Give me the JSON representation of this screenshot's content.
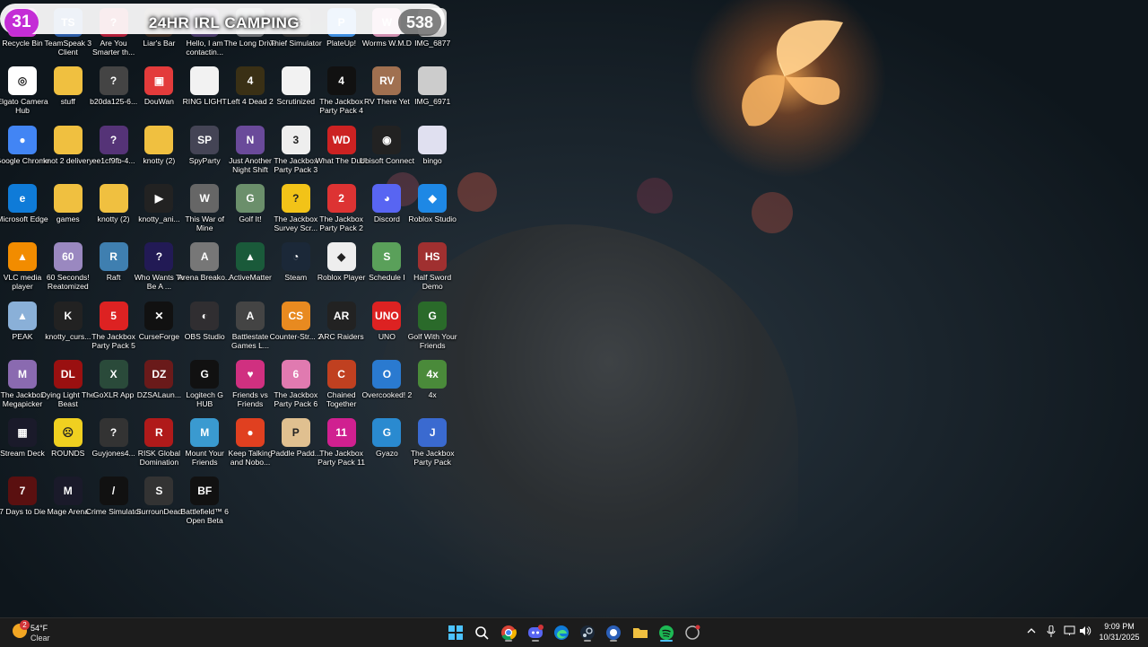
{
  "banner": {
    "left_count": "31",
    "title": "24HR IRL CAMPING",
    "right_count": "538"
  },
  "desktop_icons": [
    [
      "Recycle Bin",
      "recycle-bin-icon",
      "#cc33cc",
      ""
    ],
    [
      "TeamSpeak 3 Client",
      "teamspeak-icon",
      "#2d5ea8",
      "TS"
    ],
    [
      "Are You Smarter th...",
      "are-you-smarter-icon",
      "#b31f3a",
      "?"
    ],
    [
      "Liar's Bar",
      "liars-bar-icon",
      "#3a2a20",
      "LB"
    ],
    [
      "Hello, I am contactin...",
      "game-icon",
      "#4a3a6a",
      "H"
    ],
    [
      "The Long Drive",
      "the-long-drive-icon",
      "#6b6e72",
      "LD"
    ],
    [
      "Thief Simulator",
      "thief-simulator-icon",
      "#333",
      "TS"
    ],
    [
      "PlateUp!",
      "plateup-icon",
      "#3f8ee0",
      "P"
    ],
    [
      "Worms W.M.D",
      "worms-icon",
      "#d08fb0",
      "W"
    ],
    [
      "IMG_6877",
      "image-file-icon",
      "#ccc",
      ""
    ],
    [
      "Elgato Camera Hub",
      "elgato-camera-icon",
      "#fff",
      "◎"
    ],
    [
      "stuff",
      "folder-icon",
      "#f0c040",
      ""
    ],
    [
      "b20da125-6...",
      "file-icon",
      "#444",
      "?"
    ],
    [
      "DouWan",
      "douwan-icon",
      "#e33b3b",
      "▣"
    ],
    [
      "RING LIGHT",
      "text-file-icon",
      "#f2f2f2",
      ""
    ],
    [
      "Left 4 Dead 2",
      "left4dead2-icon",
      "#3a3015",
      "4"
    ],
    [
      "Scrutinized",
      "text-file-icon",
      "#f2f2f2",
      ""
    ],
    [
      "The Jackbox Party Pack 4",
      "jackbox-icon",
      "#111",
      "4"
    ],
    [
      "RV There Yet",
      "rv-there-yet-icon",
      "#a07050",
      "RV"
    ],
    [
      "IMG_6971",
      "image-file-icon",
      "#ccc",
      ""
    ],
    [
      "Google Chrome",
      "chrome-icon",
      "#4285f4",
      "●"
    ],
    [
      "knot 2 delivery",
      "folder-icon",
      "#f0c040",
      ""
    ],
    [
      "ee1cf9fb-4...",
      "file-icon",
      "#553377",
      "?"
    ],
    [
      "knotty (2)",
      "folder-icon",
      "#f0c040",
      ""
    ],
    [
      "SpyParty",
      "spyparty-icon",
      "#445",
      "SP"
    ],
    [
      "Just Another Night Shift",
      "night-shift-icon",
      "#6a4a9a",
      "N"
    ],
    [
      "The Jackbox Party Pack 3",
      "jackbox-icon",
      "#eee",
      "3"
    ],
    [
      "What The Dub!",
      "what-the-dub-icon",
      "#c22",
      "WD"
    ],
    [
      "Ubisoft Connect",
      "ubisoft-icon",
      "#222",
      "◉"
    ],
    [
      "bingo",
      "image-file-icon",
      "#e0e0f0",
      ""
    ],
    [
      "Microsoft Edge",
      "edge-icon",
      "#0f7bd8",
      "e"
    ],
    [
      "games",
      "folder-icon",
      "#f0c040",
      ""
    ],
    [
      "knotty (2)",
      "folder-icon",
      "#f0c040",
      ""
    ],
    [
      "knotty_ani...",
      "video-file-icon",
      "#222",
      "▶"
    ],
    [
      "This War of Mine",
      "this-war-of-mine-icon",
      "#666",
      "W"
    ],
    [
      "Golf It!",
      "golf-it-icon",
      "#6b8f6b",
      "G"
    ],
    [
      "The Jackbox Survey Scr...",
      "jackbox-icon",
      "#f2c318",
      "?"
    ],
    [
      "The Jackbox Party Pack 2",
      "jackbox-icon",
      "#d33",
      "2"
    ],
    [
      "Discord",
      "discord-icon",
      "#5865f2",
      "◕"
    ],
    [
      "Roblox Studio",
      "roblox-studio-icon",
      "#1e88e5",
      "◆"
    ],
    [
      "VLC media player",
      "vlc-icon",
      "#f28c00",
      "▲"
    ],
    [
      "60 Seconds! Reatomized",
      "sixty-seconds-icon",
      "#9a88c0",
      "60"
    ],
    [
      "Raft",
      "raft-icon",
      "#3f7fb0",
      "R"
    ],
    [
      "Who Wants To Be A ...",
      "millionaire-icon",
      "#221a55",
      "?"
    ],
    [
      "Arena Breako...",
      "arena-breakout-icon",
      "#777",
      "A"
    ],
    [
      "ActiveMatter",
      "active-matter-icon",
      "#1a5a3a",
      "▲"
    ],
    [
      "Steam",
      "steam-icon",
      "#1b2838",
      "◔"
    ],
    [
      "Roblox Player",
      "roblox-icon",
      "#eee",
      "◆"
    ],
    [
      "Schedule I",
      "schedule-one-icon",
      "#5aa05a",
      "S"
    ],
    [
      "Half Sword Demo",
      "half-sword-icon",
      "#a03030",
      "HS"
    ],
    [
      "PEAK",
      "peak-icon",
      "#8ab0d8",
      "▲"
    ],
    [
      "knotty_curs...",
      "cursor-file-icon",
      "#222",
      "K"
    ],
    [
      "The Jackbox Party Pack 5",
      "jackbox-icon",
      "#d22",
      "5"
    ],
    [
      "CurseForge",
      "curseforge-icon",
      "#111",
      "✕"
    ],
    [
      "OBS Studio",
      "obs-icon",
      "#302e31",
      "◐"
    ],
    [
      "Battlestate Games L...",
      "battlestate-icon",
      "#444",
      "A"
    ],
    [
      "Counter-Str... 2",
      "counter-strike-icon",
      "#e88a20",
      "CS"
    ],
    [
      "ARC Raiders",
      "arc-raiders-icon",
      "#222",
      "AR"
    ],
    [
      "UNO",
      "uno-icon",
      "#d22",
      "UNO"
    ],
    [
      "Golf With Your Friends",
      "golf-with-friends-icon",
      "#2a6a2a",
      "G"
    ],
    [
      "The Jackbox Megapicker",
      "jackbox-icon",
      "#8a6ab0",
      "M"
    ],
    [
      "Dying Light The Beast",
      "dying-light-icon",
      "#9a1010",
      "DL"
    ],
    [
      "GoXLR App",
      "goxlr-icon",
      "#2a4a3a",
      "X"
    ],
    [
      "DZSALaun...",
      "dzsa-icon",
      "#6a1a1a",
      "DZ"
    ],
    [
      "Logitech G HUB",
      "logitech-icon",
      "#111",
      "G"
    ],
    [
      "Friends vs Friends",
      "friends-vs-friends-icon",
      "#d03080",
      "♥"
    ],
    [
      "The Jackbox Party Pack 6",
      "jackbox-icon",
      "#e07ab0",
      "6"
    ],
    [
      "Chained Together",
      "chained-together-icon",
      "#c04020",
      "C"
    ],
    [
      "Overcooked! 2",
      "overcooked-icon",
      "#2a7ad0",
      "O"
    ],
    [
      "4x",
      "shortcut-icon",
      "#4a8a3a",
      "4x"
    ],
    [
      "Stream Deck",
      "stream-deck-icon",
      "#1a1a2a",
      "▦"
    ],
    [
      "ROUNDS",
      "rounds-icon",
      "#f0d020",
      "☹"
    ],
    [
      "Guyjones4...",
      "file-icon",
      "#333",
      "?"
    ],
    [
      "RISK Global Domination",
      "risk-icon",
      "#b01a1a",
      "R"
    ],
    [
      "Mount Your Friends",
      "mount-your-friends-icon",
      "#3a9ad0",
      "M"
    ],
    [
      "Keep Talking and Nobo...",
      "keep-talking-icon",
      "#e04020",
      "●"
    ],
    [
      "Paddle Padd...",
      "paddle-icon",
      "#e0c090",
      "P"
    ],
    [
      "The Jackbox Party Pack 11",
      "jackbox-icon",
      "#d02090",
      "11"
    ],
    [
      "Gyazo",
      "gyazo-icon",
      "#2a8ad0",
      "G"
    ],
    [
      "The Jackbox Party Pack",
      "jackbox-icon",
      "#3a6ad0",
      "J"
    ],
    [
      "7 Days to Die",
      "seven-days-icon",
      "#5a1010",
      "7"
    ],
    [
      "Mage Arena",
      "mage-arena-icon",
      "#1a1a2a",
      "M"
    ],
    [
      "Crime Simulator",
      "crime-simulator-icon",
      "#111",
      "/"
    ],
    [
      "SurrounDead",
      "surroundead-icon",
      "#333",
      "S"
    ],
    [
      "Battlefield™ 6 Open Beta",
      "battlefield-icon",
      "#111",
      "BF"
    ]
  ],
  "taskbar": {
    "weather_temp": "54°F",
    "weather_cond": "Clear",
    "weather_badge": "2",
    "time": "9:09 PM",
    "date": "10/31/2025"
  }
}
